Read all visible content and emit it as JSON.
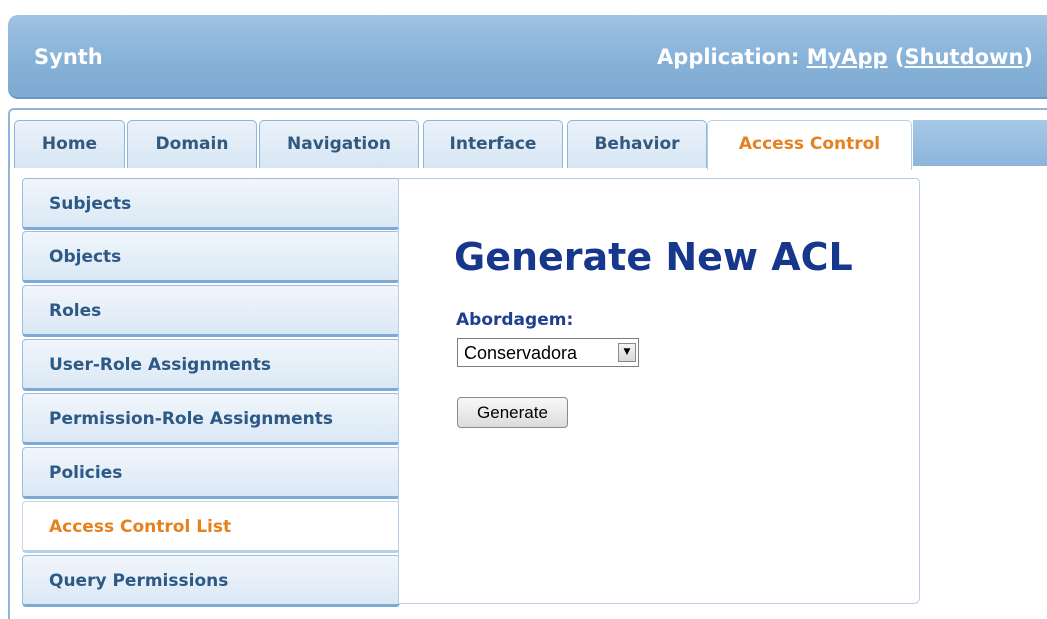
{
  "header": {
    "brand": "Synth",
    "app_prefix": "Application: ",
    "app_name": "MyApp",
    "open_paren": " (",
    "shutdown_label": "Shutdown",
    "close_paren": ")"
  },
  "tabs": [
    {
      "label": "Home",
      "active": false
    },
    {
      "label": "Domain",
      "active": false
    },
    {
      "label": "Navigation",
      "active": false
    },
    {
      "label": "Interface",
      "active": false
    },
    {
      "label": "Behavior",
      "active": false
    },
    {
      "label": "Access Control",
      "active": true
    }
  ],
  "sidebar": {
    "items": [
      {
        "label": "Subjects",
        "active": false
      },
      {
        "label": "Objects",
        "active": false
      },
      {
        "label": "Roles",
        "active": false
      },
      {
        "label": "User-Role Assignments",
        "active": false
      },
      {
        "label": "Permission-Role Assignments",
        "active": false
      },
      {
        "label": "Policies",
        "active": false
      },
      {
        "label": "Access Control List",
        "active": true
      },
      {
        "label": "Query Permissions",
        "active": false
      }
    ]
  },
  "main": {
    "title": "Generate New ACL",
    "approach_label": "Abordagem:",
    "approach_value": "Conservadora",
    "generate_label": "Generate"
  },
  "colors": {
    "header_blue": "#87b2d8",
    "nav_text": "#2c5985",
    "active_orange": "#e5821f",
    "title_navy": "#16378c"
  },
  "icons": {
    "select_arrow": "triangle-down"
  }
}
